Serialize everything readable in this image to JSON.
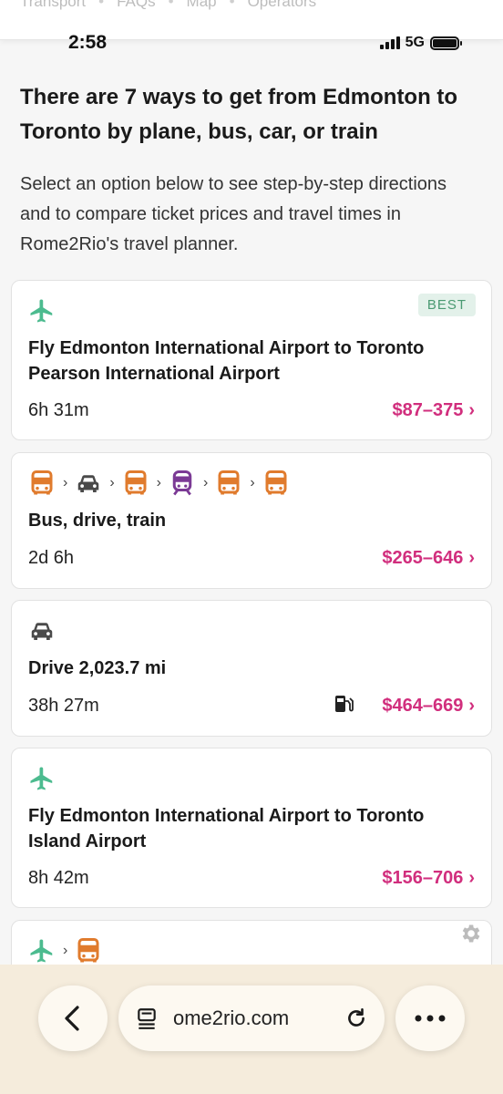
{
  "topnav": {
    "links": [
      "Transport",
      "FAQs",
      "Map",
      "Operators"
    ]
  },
  "status": {
    "time": "2:58",
    "network": "5G"
  },
  "heading": "There are 7 ways to get from Edmonton to Toronto by plane, bus, car, or train",
  "intro": "Select an option below to see step-by-step directions and to compare ticket prices and travel times in Rome2Rio's travel planner.",
  "colors": {
    "plane": "#4cbb8f",
    "bus": "#e07b2d",
    "car": "#4a4a4a",
    "train": "#7b3a95",
    "price": "#d12e7d",
    "badge_bg": "#e3f1ea",
    "badge_text": "#4a9a72"
  },
  "routes": [
    {
      "icons": [
        "plane-icon"
      ],
      "badge": "BEST",
      "title": "Fly Edmonton International Airport to Toronto Pearson International Airport",
      "duration": "6h 31m",
      "price": "$87–375"
    },
    {
      "icons": [
        "bus-icon",
        "car-icon",
        "bus-icon",
        "train-icon",
        "bus-icon",
        "bus-icon"
      ],
      "title": "Bus, drive, train",
      "duration": "2d 6h",
      "price": "$265–646"
    },
    {
      "icons": [
        "car-icon"
      ],
      "title": "Drive 2,023.7 mi",
      "duration": "38h 27m",
      "price": "$464–669",
      "extra_icon": "fuel-pump-icon"
    },
    {
      "icons": [
        "plane-icon"
      ],
      "title": "Fly Edmonton International Airport to Toronto Island Airport",
      "duration": "8h 42m",
      "price": "$156–706"
    },
    {
      "icons": [
        "plane-icon",
        "bus-icon"
      ]
    }
  ],
  "browser": {
    "url": "ome2rio.com"
  }
}
